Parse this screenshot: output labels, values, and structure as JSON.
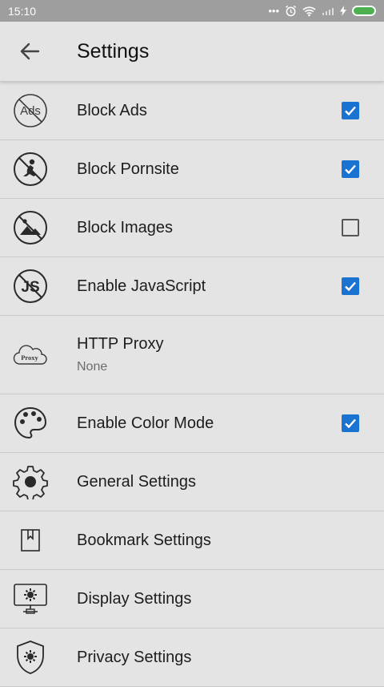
{
  "status": {
    "time": "15:10"
  },
  "header": {
    "title": "Settings"
  },
  "items": [
    {
      "label": "Block Ads",
      "icon": "block-ads-icon",
      "checked": true
    },
    {
      "label": "Block Pornsite",
      "icon": "block-pornsite-icon",
      "checked": true
    },
    {
      "label": "Block Images",
      "icon": "block-images-icon",
      "checked": false
    },
    {
      "label": "Enable JavaScript",
      "icon": "javascript-icon",
      "checked": true
    },
    {
      "label": "HTTP Proxy",
      "sub": "None",
      "icon": "proxy-cloud-icon"
    },
    {
      "label": "Enable Color Mode",
      "icon": "palette-icon",
      "checked": true
    },
    {
      "label": "General Settings",
      "icon": "gear-icon"
    },
    {
      "label": "Bookmark Settings",
      "icon": "bookmark-icon"
    },
    {
      "label": "Display Settings",
      "icon": "display-icon"
    },
    {
      "label": "Privacy Settings",
      "icon": "shield-icon"
    }
  ],
  "colors": {
    "accent": "#1a73d1",
    "background": "#e4e4e4",
    "statusbar": "#9e9e9e"
  }
}
